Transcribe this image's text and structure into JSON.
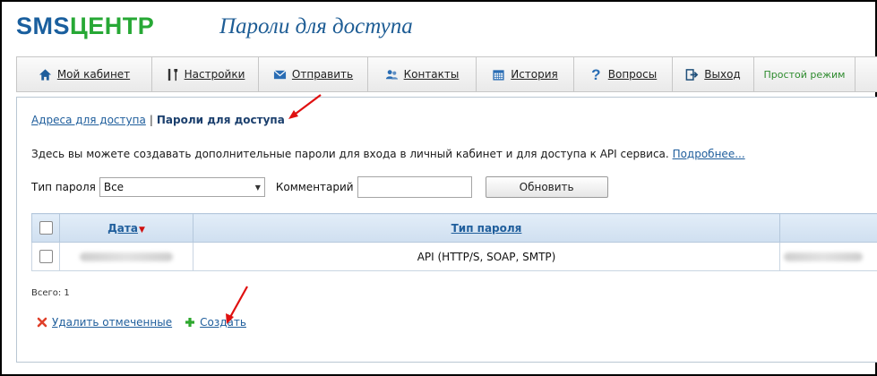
{
  "brand": {
    "logo_part1": "SMS",
    "logo_part2": "ЦЕНТР",
    "page_title": "Пароли для доступа"
  },
  "nav": {
    "items": [
      {
        "label": "Мой кабинет",
        "icon": "home-icon"
      },
      {
        "label": "Настройки",
        "icon": "tools-icon"
      },
      {
        "label": "Отправить",
        "icon": "envelope-icon"
      },
      {
        "label": "Контакты",
        "icon": "contacts-icon"
      },
      {
        "label": "История",
        "icon": "calendar-icon"
      },
      {
        "label": "Вопросы",
        "icon": "question-icon"
      },
      {
        "label": "Выход",
        "icon": "exit-icon"
      }
    ],
    "simple_mode": "Простой режим"
  },
  "breadcrumb": {
    "link": "Адреса для доступа",
    "separator": "|",
    "current": "Пароли для доступа"
  },
  "description": {
    "text": "Здесь вы можете создавать дополнительные пароли для входа в личный кабинет и для доступа к API сервиса.",
    "more_link": "Подробнее..."
  },
  "filters": {
    "type_label": "Тип пароля",
    "type_value": "Все",
    "comment_label": "Комментарий",
    "comment_value": "",
    "refresh_button": "Обновить"
  },
  "table": {
    "columns": [
      "Дата",
      "Тип пароля"
    ],
    "rows": [
      {
        "type": "API (HTTP/S, SOAP, SMTP)"
      }
    ]
  },
  "summary": {
    "total": "Всего: 1"
  },
  "actions": {
    "delete_label": "Удалить отмеченные",
    "create_label": "Создать"
  },
  "colors": {
    "brand_blue": "#1a5f9e",
    "brand_green": "#27a835",
    "link": "#1f5e9c",
    "arrow_red": "#e01010"
  }
}
